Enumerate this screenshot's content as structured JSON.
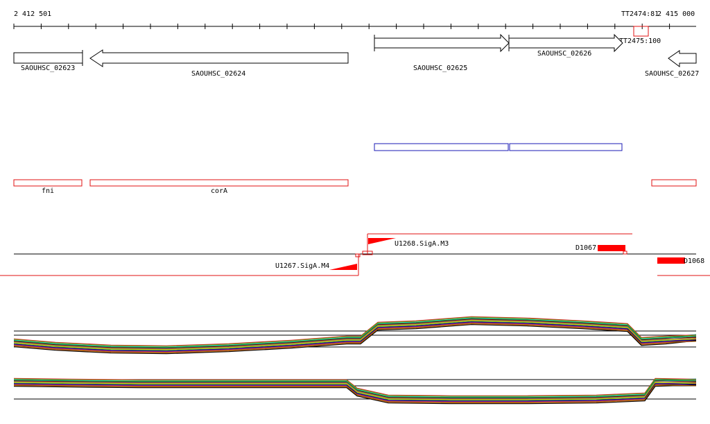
{
  "ruler": {
    "start_label": "2 412 501",
    "end_label": "2 415 000"
  },
  "terminators": [
    "TT2474:81",
    "TT2475:100"
  ],
  "genes": [
    {
      "id": "SAOUHSC_02623",
      "strand": "+"
    },
    {
      "id": "SAOUHSC_02624",
      "strand": "-"
    },
    {
      "id": "SAOUHSC_02625",
      "strand": "+"
    },
    {
      "id": "SAOUHSC_02626",
      "strand": "+"
    },
    {
      "id": "SAOUHSC_02627",
      "strand": "-"
    }
  ],
  "operon_track": {
    "color": "#1a1ab4"
  },
  "annotation_track": {
    "color": "#e01010",
    "names": [
      "fni",
      "corA"
    ]
  },
  "tss_track": {
    "line_color": "#e01010",
    "promoters": [
      "U1268.SigA.M3",
      "U1267.SigA.M4"
    ],
    "transcripts": [
      "D1067",
      "D1068"
    ]
  },
  "expression": {
    "series_colors": [
      "#e6194b",
      "#3cb44b",
      "#4363d8",
      "#f58231",
      "#911eb4",
      "#46f0f0",
      "#f032e6",
      "#bcf60c",
      "#008080",
      "#9a6324",
      "#800000",
      "#808000",
      "#000075",
      "#808080",
      "#000000",
      "#c0a000",
      "#00a050",
      "#a05000"
    ]
  }
}
